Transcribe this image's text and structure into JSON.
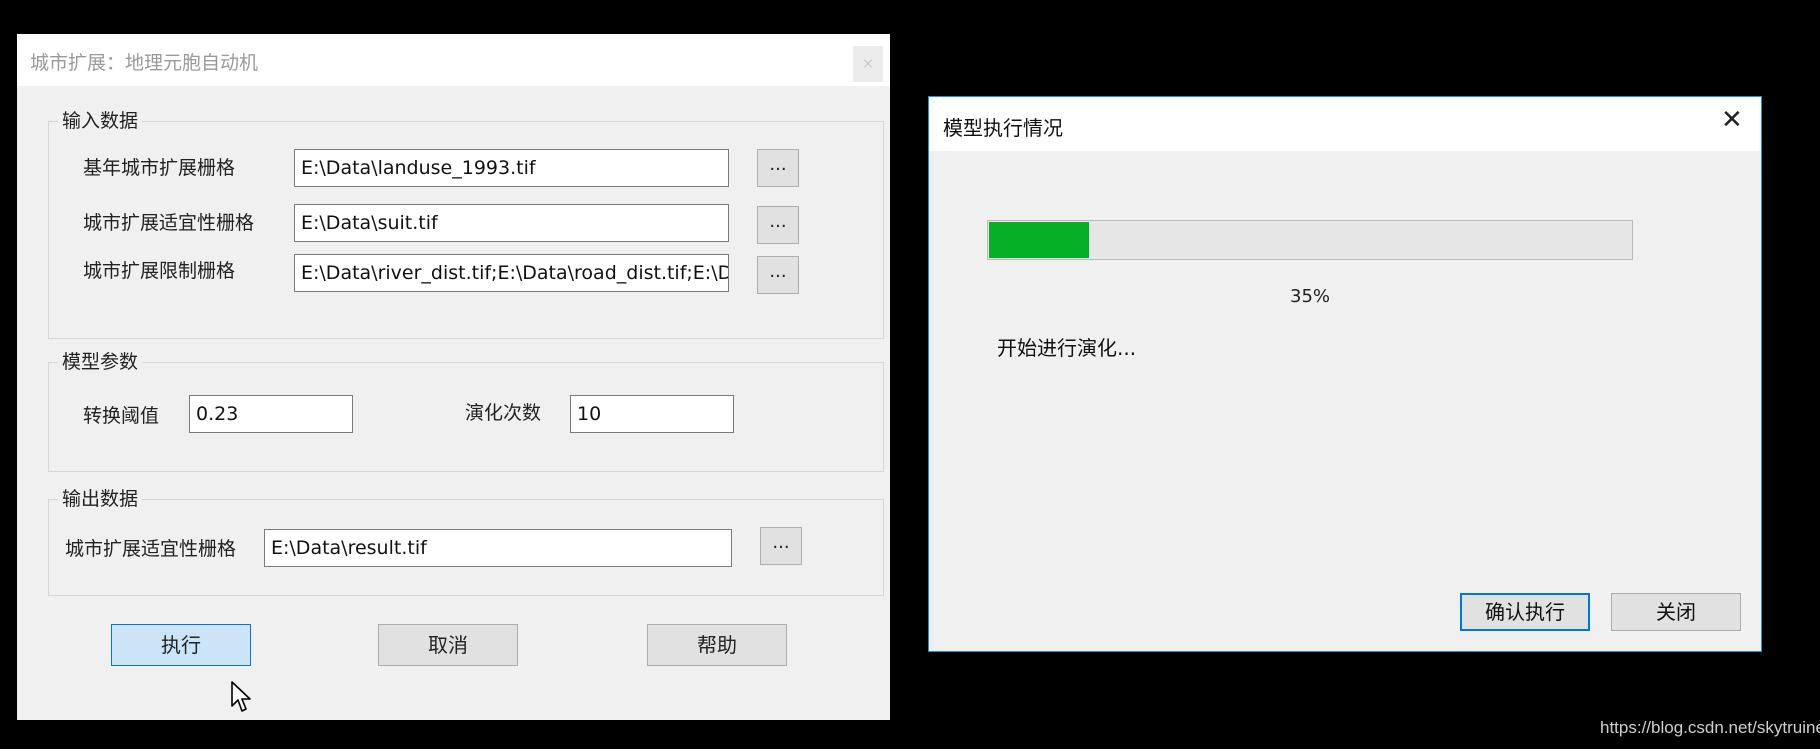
{
  "main_dialog": {
    "title": "城市扩展：地理元胞自动机",
    "close_glyph": "×",
    "input_group": {
      "legend": "输入数据",
      "rows": [
        {
          "label": "基年城市扩展栅格",
          "value": "E:\\Data\\landuse_1993.tif",
          "browse": "..."
        },
        {
          "label": "城市扩展适宜性栅格",
          "value": "E:\\Data\\suit.tif",
          "browse": "..."
        },
        {
          "label": "城市扩展限制栅格",
          "value": "E:\\Data\\river_dist.tif;E:\\Data\\road_dist.tif;E:\\Dat",
          "browse": "..."
        }
      ]
    },
    "param_group": {
      "legend": "模型参数",
      "threshold_label": "转换阈值",
      "threshold_value": "0.23",
      "iterations_label": "演化次数",
      "iterations_value": "10"
    },
    "output_group": {
      "legend": "输出数据",
      "label": "城市扩展适宜性栅格",
      "value": "E:\\Data\\result.tif",
      "browse": "..."
    },
    "buttons": {
      "execute": "执行",
      "cancel": "取消",
      "help": "帮助"
    }
  },
  "progress_dialog": {
    "title": "模型执行情况",
    "close_glyph": "✕",
    "progress_fraction": 0.155,
    "progress_text": "35%",
    "status_text": "开始进行演化...",
    "buttons": {
      "confirm": "确认执行",
      "close": "关闭"
    }
  },
  "watermark": "https://blog.csdn.net/skytruine",
  "colors": {
    "progress_fill": "#06b025",
    "accent_border": "#0078d7"
  }
}
